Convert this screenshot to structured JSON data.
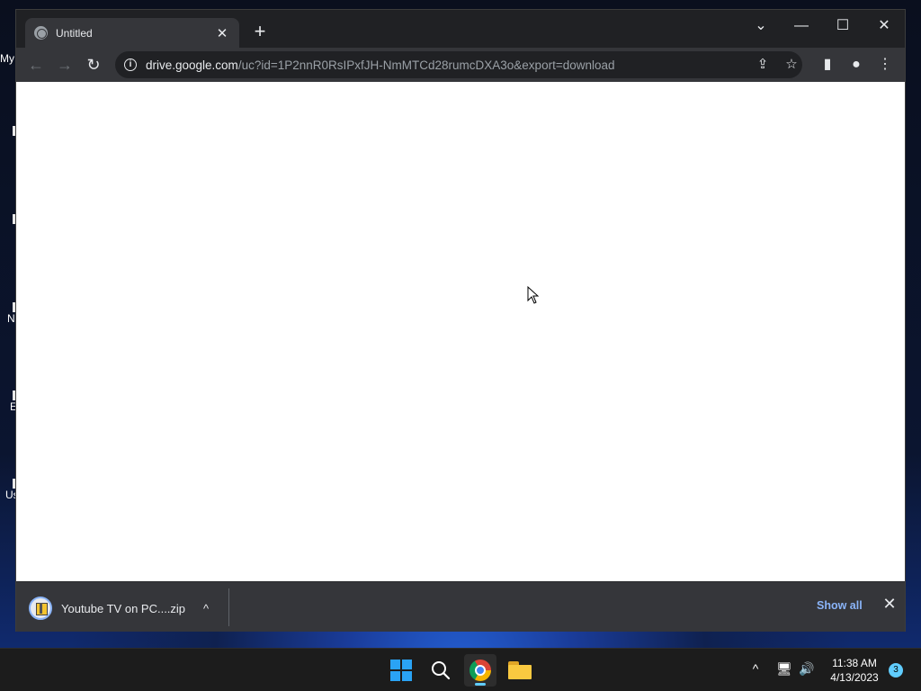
{
  "desktop": {
    "peek_labels": [
      "My",
      "N",
      "E",
      "Us"
    ]
  },
  "browser": {
    "tab": {
      "title": "Untitled",
      "favicon": "globe-icon",
      "close": "✕"
    },
    "new_tab": "+",
    "window_controls": {
      "tab_search": "⌄",
      "minimize": "—",
      "maximize": "☐",
      "close": "✕"
    },
    "nav": {
      "back": "←",
      "forward": "→",
      "reload": "↻"
    },
    "omnibox": {
      "host": "drive.google.com",
      "path": "/uc?id=1P2nnR0RsIPxfJH-NmMTCd28rumcDXA3o&export=download",
      "info_icon": "i"
    },
    "omnibox_actions": {
      "share": "⇪",
      "bookmark": "☆"
    },
    "toolbar_actions": {
      "side_panel": "▮",
      "profile": "●",
      "menu": "⋮"
    }
  },
  "download_bar": {
    "file_name": "Youtube TV on PC....zip",
    "caret": "^",
    "show_all": "Show all",
    "close": "✕"
  },
  "taskbar": {
    "apps": [
      "start",
      "search",
      "chrome",
      "file-explorer"
    ],
    "tray": {
      "chevron": "^",
      "network": "🖥",
      "volume": "🔊"
    },
    "clock": {
      "time": "11:38 AM",
      "date": "4/13/2023"
    },
    "notification_count": "3"
  },
  "colors": {
    "accent": "#8ab4f8",
    "titlebar": "#202124",
    "toolbar": "#35363a",
    "taskbar": "#1c1c1c"
  }
}
